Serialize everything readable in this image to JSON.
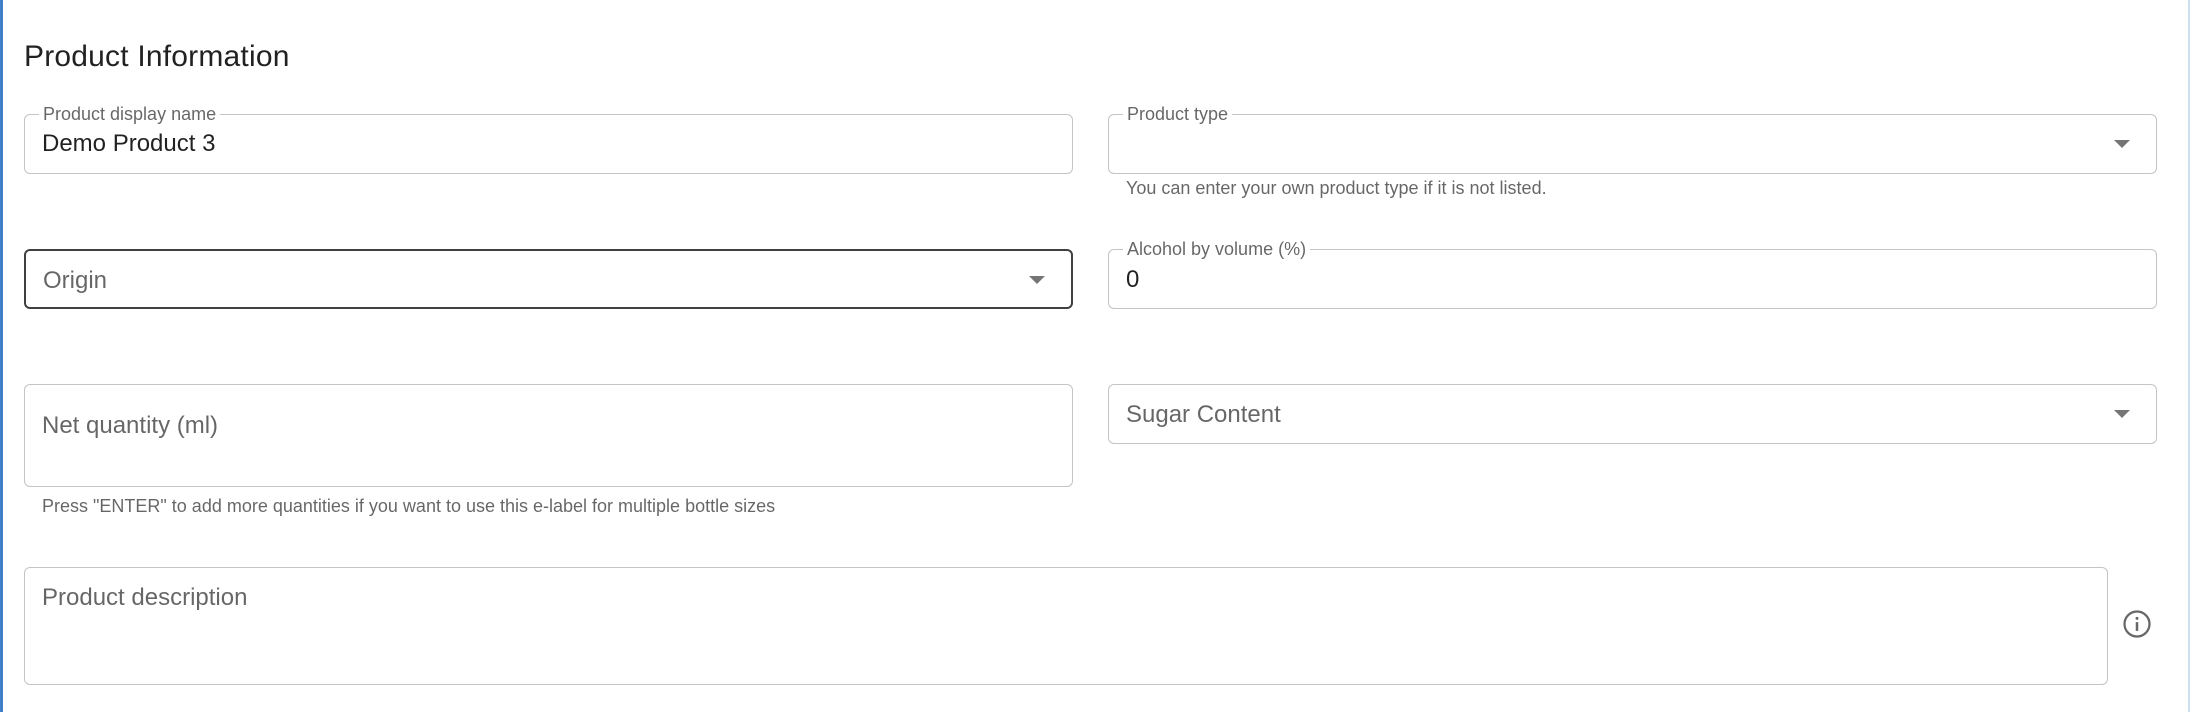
{
  "section": {
    "title": "Product Information"
  },
  "fields": {
    "display_name": {
      "label": "Product display name",
      "value": "Demo Product 3"
    },
    "product_type": {
      "label": "Product type",
      "value": "",
      "helper": "You can enter your own product type if it is not listed."
    },
    "origin": {
      "placeholder": "Origin"
    },
    "abv": {
      "label": "Alcohol by volume (%)",
      "value": "0"
    },
    "net_quantity": {
      "placeholder": "Net quantity (ml)",
      "helper": "Press \"ENTER\" to add more quantities if you want to use this e-label for multiple bottle sizes"
    },
    "sugar_content": {
      "placeholder": "Sugar Content"
    },
    "description": {
      "placeholder": "Product description"
    }
  },
  "icons": {
    "dropdown": "chevron-down-icon",
    "info": "info-icon"
  },
  "colors": {
    "accent_edge": "#3f7fc8",
    "border": "#c4c4c4",
    "text": "#212121",
    "muted": "#666666"
  }
}
